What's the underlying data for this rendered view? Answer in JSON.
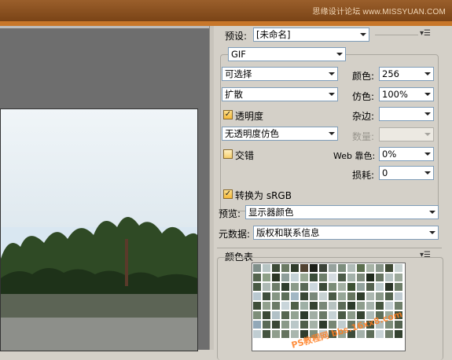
{
  "watermark_top": "思缘设计论坛 www.MISSYUAN.COM",
  "panel": {
    "preset_label": "预设:",
    "preset_value": "[未命名]",
    "format_value": "GIF",
    "reduction_value": "可选择",
    "dither_algo_value": "扩散",
    "transparency_label": "透明度",
    "transparency_dither_value": "无透明度仿色",
    "interlaced_label": "交错",
    "colors_label": "颜色:",
    "colors_value": "256",
    "dither_label": "仿色:",
    "dither_value": "100%",
    "matte_label": "杂边:",
    "matte_value": "",
    "amount_label": "数量:",
    "amount_value": "",
    "web_snap_label": "Web 靠色:",
    "web_snap_value": "0%",
    "lossy_label": "损耗:",
    "lossy_value": "0",
    "srgb_label": "转换为 sRGB",
    "preview_label": "预览:",
    "preview_value": "显示器颜色",
    "metadata_label": "元数据:",
    "metadata_value": "版权和联系信息",
    "color_table_label": "颜色表"
  },
  "watermark_bottom": "PS教程网 bbs.16xx8.com",
  "swatch_colors": [
    "#7f8f8a",
    "#b7c5c4",
    "#3c4a36",
    "#6b7a63",
    "#2f3b2a",
    "#514331",
    "#1c1f18",
    "#3c4338",
    "#97a29d",
    "#7d8d7d",
    "#b1bcb8",
    "#5c6f4f",
    "#a7b3a6",
    "#89968a",
    "#3f4a35",
    "#c9d3d2",
    "#55654f",
    "#8da087",
    "#2b3624",
    "#8e9e9a",
    "#c4d1d6",
    "#98a893",
    "#3b4d3a",
    "#6e7f6b",
    "#d4dbe0",
    "#4c5b49",
    "#a3b1aa",
    "#7d8a7b",
    "#1f2a1c",
    "#667562",
    "#b4c1c0",
    "#9ca99b",
    "#495a44",
    "#adb9b4",
    "#6e7d6a",
    "#2f3d2d",
    "#8b9a89",
    "#5a6a57",
    "#cbd7dc",
    "#3b4a38",
    "#7b8c78",
    "#a3b0a3",
    "#3c5033",
    "#93a39e",
    "#546250",
    "#bccacc",
    "#2a3427",
    "#6d7d68",
    "#b9c8d0",
    "#404f3d",
    "#869684",
    "#5e6f5b",
    "#a2b7c4",
    "#3a4836",
    "#7a897a",
    "#c7d2d2",
    "#4a5a47",
    "#96a697",
    "#66755f",
    "#2f3d2c",
    "#abb7b0",
    "#8a998a",
    "#53634f",
    "#bfcad0",
    "#3e4e3a",
    "#91a08e",
    "#6b7a67",
    "#c9d5da",
    "#4f6047",
    "#9fb0a6",
    "#344231",
    "#798878",
    "#b6c2c0",
    "#5c6b58",
    "#2c3a2a",
    "#8e9d8c",
    "#a6b3ab",
    "#46563f",
    "#c3ced0",
    "#6f7f6a",
    "#7d8e7a",
    "#3b4937",
    "#b2c1c7",
    "#566650",
    "#93a392",
    "#2d3a2b",
    "#a1aea4",
    "#6a7967",
    "#c5d1d4",
    "#495944",
    "#8c9b8a",
    "#354331",
    "#aebbb8",
    "#5f6f5a",
    "#9aa99a",
    "#40503b",
    "#92a8b8",
    "#5b6b56",
    "#3a4735",
    "#8a9a88",
    "#bac7c8",
    "#4e5e4a",
    "#a5b2a7",
    "#2e3b2c",
    "#778674",
    "#c2cdcf",
    "#6a7a65",
    "#99a79a",
    "#42523e",
    "#b0bdbb",
    "#7e8e7b",
    "#536350",
    "#c0cdd2",
    "#44543f",
    "#8f9e8d",
    "#65745f",
    "#a9b6ae",
    "#2f3c2d",
    "#7f8f7c",
    "#bfcbcd",
    "#4b5b47",
    "#96a495",
    "#3d4b39",
    "#a4b1aa",
    "#5d6d59",
    "#c8d3d6",
    "#707f6c",
    "#33412f"
  ]
}
